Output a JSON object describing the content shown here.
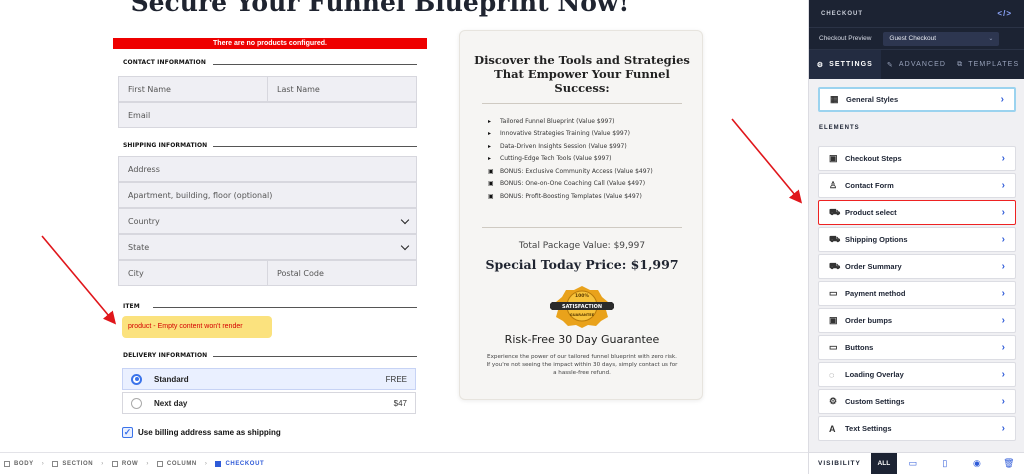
{
  "page": {
    "heading": "Secure Your Funnel Blueprint Now!"
  },
  "form": {
    "error_text": "There are no products configured.",
    "contact_label": "CONTACT INFORMATION",
    "first_name": "First Name",
    "last_name": "Last Name",
    "email": "Email",
    "shipping_label": "SHIPPING INFORMATION",
    "address": "Address",
    "apartment": "Apartment, building, floor (optional)",
    "country": "Country",
    "state": "State",
    "city": "City",
    "postal": "Postal Code",
    "item_label": "ITEM",
    "item_warning": "product - Empty content won't render",
    "delivery_label": "DELIVERY INFORMATION",
    "delivery_options": [
      {
        "label": "Standard",
        "price": "FREE",
        "selected": true
      },
      {
        "label": "Next day",
        "price": "$47",
        "selected": false
      }
    ],
    "billing_label": "Use billing address same as shipping"
  },
  "offer": {
    "title": "Discover the Tools and Strategies That Empower Your Funnel Success:",
    "bullets": [
      {
        "icon": "triangle-icon",
        "text": "Tailored Funnel Blueprint (Value $997)"
      },
      {
        "icon": "triangle-icon",
        "text": "Innovative Strategies Training (Value $997)"
      },
      {
        "icon": "triangle-icon",
        "text": "Data-Driven Insights Session (Value $997)"
      },
      {
        "icon": "triangle-icon",
        "text": "Cutting-Edge Tech Tools (Value $997)"
      },
      {
        "icon": "gift-icon",
        "text": "BONUS: Exclusive Community Access (Value $497)"
      },
      {
        "icon": "gift-icon",
        "text": "BONUS: One-on-One Coaching Call (Value $497)"
      },
      {
        "icon": "gift-icon",
        "text": "BONUS: Profit-Boosting Templates (Value $497)"
      }
    ],
    "total": "Total Package Value: $9,997",
    "special": "Special Today Price: $1,997",
    "badge_top": "100%",
    "badge_main": "SATISFACTION",
    "badge_sub": "GUARANTEE",
    "guarantee_title": "Risk-Free 30 Day Guarantee",
    "guarantee_text": "Experience the power of our tailored funnel blueprint with zero risk. If you're not seeing the impact within 30 days, simply contact us for a hassle-free refund."
  },
  "breadcrumb": [
    {
      "label": "BODY",
      "icon": "body-icon",
      "active": false
    },
    {
      "label": "SECTION",
      "icon": "section-icon",
      "active": false
    },
    {
      "label": "ROW",
      "icon": "row-icon",
      "active": false
    },
    {
      "label": "COLUMN",
      "icon": "column-icon",
      "active": false
    },
    {
      "label": "CHECKOUT",
      "icon": "cart-icon",
      "active": true
    }
  ],
  "sidebar": {
    "title": "CHECKOUT",
    "code_glyph": "</>",
    "preview_label": "Checkout Preview",
    "preview_value": "Guest Checkout",
    "tabs": [
      {
        "label": "SETTINGS",
        "glyph": "⚙",
        "active": true
      },
      {
        "label": "ADVANCED",
        "glyph": "✎",
        "active": false
      },
      {
        "label": "TEMPLATES",
        "glyph": "⧉",
        "active": false
      }
    ],
    "general": {
      "label": "General Styles",
      "glyph": "▦"
    },
    "elements_label": "ELEMENTS",
    "items": [
      {
        "label": "Checkout Steps",
        "glyph": "▣"
      },
      {
        "label": "Contact Form",
        "glyph": "♙"
      },
      {
        "label": "Product select",
        "glyph": "⛟"
      },
      {
        "label": "Shipping Options",
        "glyph": "⛟"
      },
      {
        "label": "Order Summary",
        "glyph": "⛟"
      },
      {
        "label": "Payment method",
        "glyph": "▭"
      },
      {
        "label": "Order bumps",
        "glyph": "▣"
      },
      {
        "label": "Buttons",
        "glyph": "▭"
      },
      {
        "label": "Loading Overlay",
        "glyph": "◌"
      },
      {
        "label": "Custom Settings",
        "glyph": "⚙"
      },
      {
        "label": "Text Settings",
        "glyph": "A"
      }
    ],
    "chevron": "›",
    "visibility_label": "VISIBILITY",
    "visibility_all": "ALL",
    "footer_icons": [
      {
        "name": "desktop-icon",
        "glyph": "▭"
      },
      {
        "name": "mobile-icon",
        "glyph": "▯"
      },
      {
        "name": "eye-icon",
        "glyph": "◉"
      },
      {
        "name": "trash-icon",
        "glyph": "🗑"
      }
    ]
  },
  "colors": {
    "accent": "#2f5bd8",
    "sidebar_dark": "#1c2333",
    "error_red": "#ee0000",
    "warning_yellow": "#fbe27e"
  }
}
